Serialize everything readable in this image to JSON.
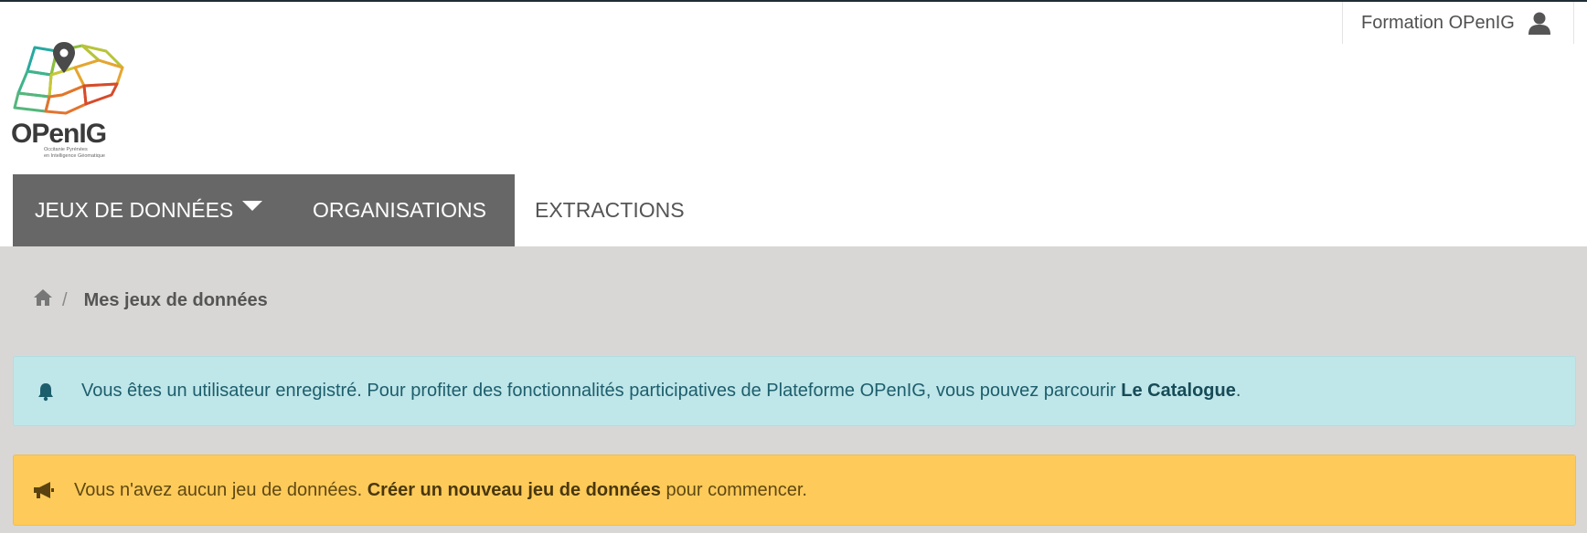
{
  "user": {
    "name": "Formation OPenIG",
    "icon": "user-icon"
  },
  "logo": {
    "wordmark": "OPenIG",
    "tagline_1": "Occitanie Pyrénées",
    "tagline_2": "en Intelligence Géomatique"
  },
  "nav": {
    "items": [
      {
        "label": "JEUX DE DONNÉES",
        "has_dropdown": true,
        "active": true
      },
      {
        "label": "ORGANISATIONS",
        "active": true
      },
      {
        "label": "EXTRACTIONS",
        "active": false
      }
    ]
  },
  "breadcrumb": {
    "home_icon": "home-icon",
    "separator": "/",
    "current": "Mes jeux de données"
  },
  "alerts": {
    "info": {
      "icon": "bell-icon",
      "text": "Vous êtes un utilisateur enregistré. Pour profiter des fonctionnalités participatives de Plateforme OPenIG, vous pouvez parcourir ",
      "link": "Le Catalogue",
      "suffix": "."
    },
    "warning": {
      "icon": "bullhorn-icon",
      "text": "Vous n'avez aucun jeu de données. ",
      "link": "Créer un nouveau jeu de données",
      "suffix": " pour commencer."
    }
  },
  "colors": {
    "nav_active": "#676767",
    "content_bg": "#d8d7d5",
    "info_bg": "#bfe6e9",
    "warning_bg": "#fecb5a"
  }
}
